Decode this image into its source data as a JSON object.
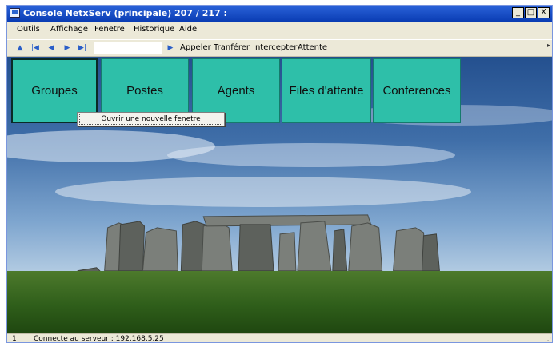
{
  "window": {
    "title": "Console NetxServ (principale) 207 / 217 :",
    "controls": {
      "minimize": "_",
      "maximize": "□",
      "close": "X"
    }
  },
  "menu": {
    "items": [
      {
        "label": "Outils"
      },
      {
        "label": "Affichage"
      },
      {
        "label": "Fenetre"
      },
      {
        "label": "Historique"
      },
      {
        "label": "Aide"
      }
    ]
  },
  "toolbar": {
    "nav_icons": [
      "nav-up-icon",
      "nav-first-icon",
      "nav-prev-icon",
      "nav-next-icon",
      "nav-last-icon"
    ],
    "goto_value": "",
    "actions": [
      {
        "label": "Appeler"
      },
      {
        "label": "Tranférer"
      },
      {
        "label": "Intercepter"
      },
      {
        "label": "Attente"
      }
    ]
  },
  "tiles": [
    {
      "label": "Groupes",
      "selected": true
    },
    {
      "label": "Postes"
    },
    {
      "label": "Agents"
    },
    {
      "label": "Files d'attente"
    },
    {
      "label": "Conferences"
    }
  ],
  "context_menu": {
    "items": [
      {
        "label": "Ouvrir une nouvelle fenetre"
      }
    ]
  },
  "status": {
    "panel_number": "1",
    "connection": "Connecte au serveur : 192.168.5.25"
  },
  "colors": {
    "tile": "#2ebfa9",
    "title_bar": "#0a3cb3",
    "window_chrome": "#ece9d8"
  }
}
